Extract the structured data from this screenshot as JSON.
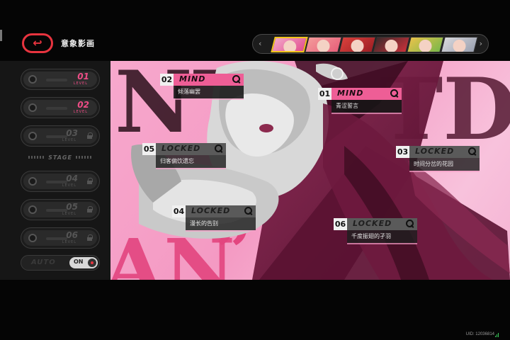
{
  "header": {
    "title": "意象影画",
    "back_icon": "back-arrow-icon"
  },
  "character_bar": {
    "prev_icon": "‹",
    "next_icon": "›",
    "portraits": [
      {
        "hair": "#f2a6c9",
        "accent": "#e24f8e",
        "active": true
      },
      {
        "hair": "#f39a9a",
        "accent": "#e8607a",
        "active": false
      },
      {
        "hair": "#d8403c",
        "accent": "#9e1f24",
        "active": false
      },
      {
        "hair": "#3d2a2a",
        "accent": "#c9303a",
        "active": false
      },
      {
        "hair": "#e8c24a",
        "accent": "#7ab84a",
        "active": false
      },
      {
        "hair": "#d8d8dc",
        "accent": "#9aa0b0",
        "active": false
      }
    ]
  },
  "levels": [
    {
      "num": "01",
      "level_text": "LEVEL",
      "state": "done"
    },
    {
      "num": "02",
      "level_text": "LEVEL",
      "state": "done"
    },
    {
      "num": "03",
      "level_text": "LEVEL",
      "state": "locked"
    },
    {
      "num": "04",
      "level_text": "LEVEL",
      "state": "locked"
    },
    {
      "num": "05",
      "level_text": "LEVEL",
      "state": "locked"
    },
    {
      "num": "06",
      "level_text": "LEVEL",
      "state": "locked"
    }
  ],
  "stage_divider": "STAGE",
  "auto": {
    "label": "AUTO",
    "state": "ON"
  },
  "markers": [
    {
      "num": "02",
      "status": "MIND",
      "subtitle": "倾落幽罢",
      "locked": false
    },
    {
      "num": "01",
      "status": "MIND",
      "subtitle": "青涩誓言",
      "locked": false
    },
    {
      "num": "05",
      "status": "LOCKED",
      "subtitle": "归客偏饮遗忘",
      "locked": true
    },
    {
      "num": "03",
      "status": "LOCKED",
      "subtitle": "时间分岔的花园",
      "locked": true
    },
    {
      "num": "04",
      "status": "LOCKED",
      "subtitle": "漫长的告别",
      "locked": true
    },
    {
      "num": "06",
      "status": "LOCKED",
      "subtitle": "千度振翅的孑羽",
      "locked": true
    }
  ],
  "art_text": {
    "big_top_left": "NT",
    "big_top_right": "TD",
    "big_bottom_left": "AN",
    "quote_mark": "”"
  },
  "footer": {
    "uid": "UID: 12036814"
  },
  "colors": {
    "accent_pink": "#ee5e96",
    "back_red": "#e8343f",
    "dark_magenta": "#6e1a3e"
  }
}
